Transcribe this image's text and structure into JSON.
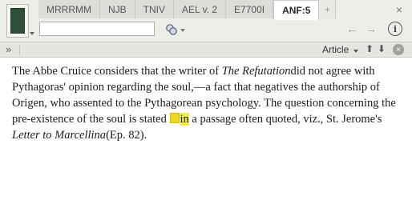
{
  "tabs": [
    "MRRRMM",
    "NJB",
    "TNIV",
    "AEL v. 2",
    "E7700I",
    "ANF:5"
  ],
  "active_tab_index": 5,
  "tab_add_label": "+",
  "close_all_label": "×",
  "search": {
    "value": ""
  },
  "nav": {
    "back": "←",
    "forward": "→",
    "info": "i"
  },
  "strip": {
    "chevron": "»",
    "article_label": "Article",
    "up": "⬆",
    "down": "⬇",
    "clear": "×"
  },
  "content": {
    "p1": "The Abbe Cruice considers that the writer of ",
    "title1": "The Refutation",
    "p2": "did not agree with Pythagoras' opinion regarding the soul,—a fact that negatives the authorship of Origen, who assented to the Pythagorean psychology. The question concerning the pre-existence of the soul is stated ",
    "highlight": "in",
    "p3": " a passage often quoted, viz., St. Jerome's ",
    "title2": "Letter to Marcellina",
    "p4": "(Ep. 82)."
  },
  "colors": {
    "highlight": "#f3ee3b",
    "toolbar": "#eceeea"
  }
}
